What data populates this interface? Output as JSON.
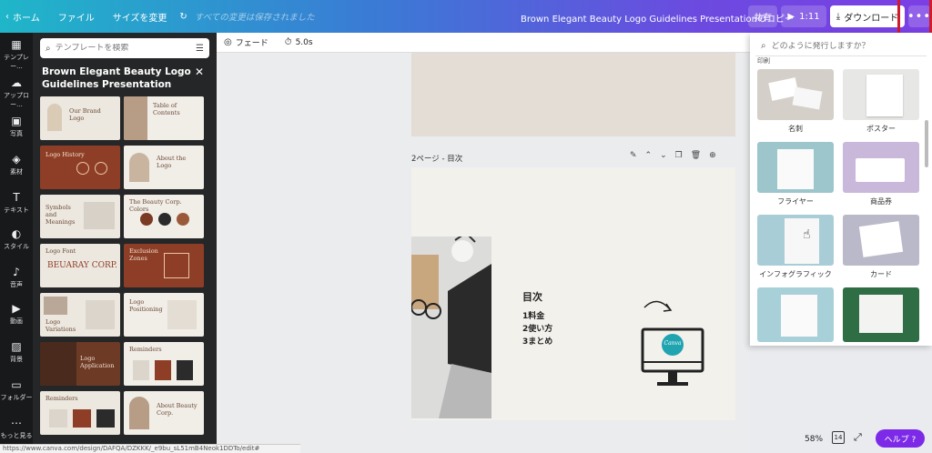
{
  "topbar": {
    "home": "ホーム",
    "file": "ファイル",
    "resize": "サイズを変更",
    "saved_status": "すべての変更は保存されました",
    "doc_title": "Brown Elegant Beauty Logo Guidelines Presentationのコピー",
    "share": "共有",
    "present_time": "1:11",
    "download": "ダウンロード",
    "more": "•••"
  },
  "rail": {
    "items": [
      "テンプレー...",
      "アップロー...",
      "写真",
      "素材",
      "テキスト",
      "スタイル",
      "音声",
      "動画",
      "背景",
      "フォルダー",
      "もっと見る"
    ]
  },
  "template_panel": {
    "search_placeholder": "テンプレートを検索",
    "title": "Brown Elegant Beauty Logo Guidelines Presentation",
    "thumbs": [
      "Our Brand Logo",
      "Table of Contents",
      "Logo History",
      "About the Logo",
      "Symbols and Meanings",
      "The Beauty Corp. Colors",
      "Logo Font",
      "Exclusion Zones",
      "BEUARAY CORP.",
      "Logo Variations",
      "Logo Positioning",
      "Reminders",
      "Logo Application",
      "Reminders",
      "About Beauty Corp."
    ]
  },
  "editor_toolbar": {
    "fade": "フェード",
    "duration": "5.0s"
  },
  "canvas": {
    "page_label": "2ページ - 目次",
    "toc_title": "目次",
    "toc_items": [
      "1料金",
      "2使い方",
      "3まとめ"
    ],
    "monitor_logo": "Canva"
  },
  "publish_panel": {
    "search_placeholder": "どのように発行しますか？",
    "section_label": "印刷",
    "cards": [
      "名刺",
      "ポスター",
      "フライヤー",
      "商品券",
      "インフォグラフィック",
      "カード",
      "",
      ""
    ]
  },
  "bottom": {
    "zoom": "58%",
    "page_count": "14",
    "help": "ヘルプ ?",
    "status_url": "https://www.canva.com/design/DAFQA/DZKKK/_e9bu_sL51mB4Neok1DDTo/edit#"
  },
  "colors": {
    "accent": "#7d2ae8",
    "highlight_box": "#d11a2a",
    "canva_teal": "#20a4b0"
  }
}
